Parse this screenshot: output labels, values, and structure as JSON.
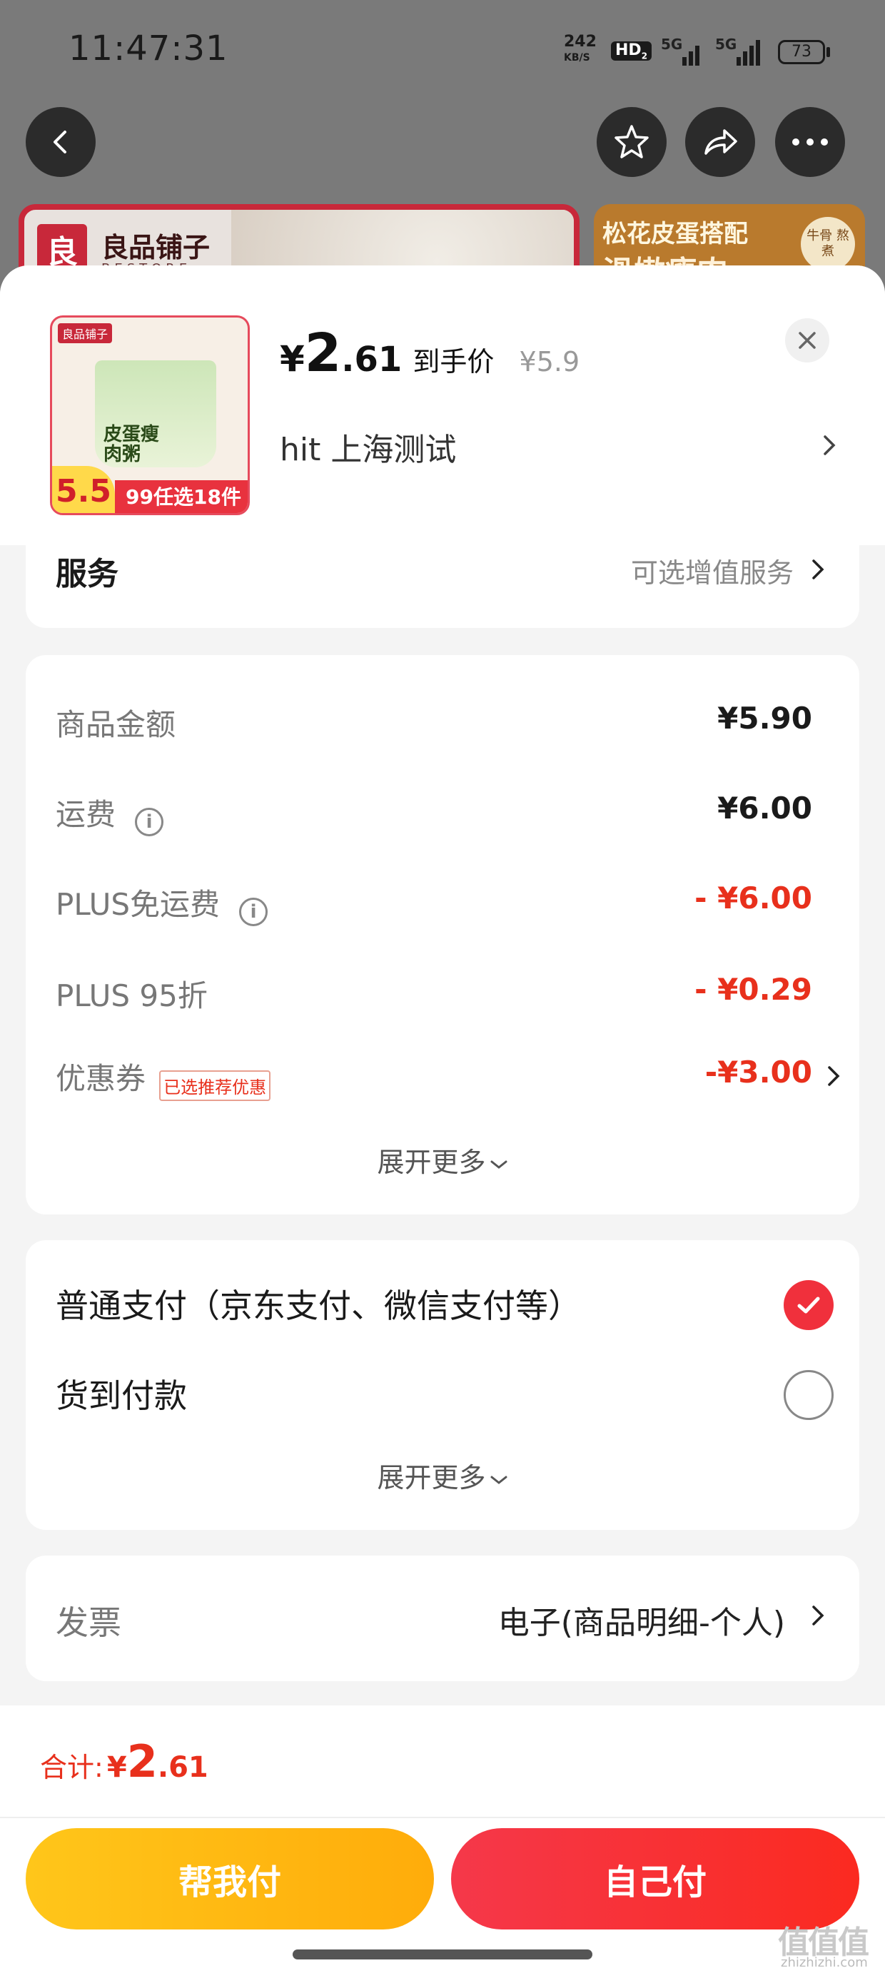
{
  "status_bar": {
    "time": "11:47:31",
    "net_speed_top": "242",
    "net_speed_bottom": "KB/S",
    "hd": "HD",
    "hd_sub": "2",
    "sig1": "5G",
    "sig2": "5G",
    "battery": "73"
  },
  "background": {
    "banner1_logo": "良",
    "banner1_name": "良品铺子",
    "banner1_sub": "BESTORE",
    "banner2_line1": "松花皮蛋搭配",
    "banner2_line2": "滑嫩瘦肉",
    "banner2_sticker": "牛骨 熬煮"
  },
  "product": {
    "currency": "¥",
    "price_int": "2",
    "price_dec": ".61",
    "price_tag": "到手价",
    "original_price": "¥5.9",
    "address": "hit  上海测试",
    "thumb_brand": "良品铺子",
    "thumb_pack_text": "皮蛋瘦肉粥",
    "thumb_price": "5.5",
    "thumb_promo": "99任选18件"
  },
  "service": {
    "label": "服务",
    "value": "可选增值服务"
  },
  "summary": {
    "rows": [
      {
        "label": "商品金额",
        "value": "¥5.90"
      },
      {
        "label": "运费",
        "value": "¥6.00"
      },
      {
        "label": "PLUS免运费",
        "value": "- ¥6.00"
      },
      {
        "label": "PLUS 95折",
        "value": "- ¥0.29"
      },
      {
        "label": "优惠券",
        "badge": "已选推荐优惠",
        "value": "-¥3.00"
      }
    ],
    "expand": "展开更多"
  },
  "payment": {
    "option1": "普通支付（京东支付、微信支付等）",
    "option2": "货到付款",
    "option1_selected": true,
    "expand": "展开更多"
  },
  "invoice": {
    "label": "发票",
    "value": "电子(商品明细-个人)"
  },
  "footer": {
    "total_label": "合计:",
    "total_currency": "¥",
    "total_int": "2",
    "total_dec": ".61",
    "btn_help": "帮我付",
    "btn_self": "自己付"
  },
  "watermark": {
    "main": "值值值",
    "sub": "zhizhizhi.com"
  },
  "colors": {
    "accent_red": "#e8301c",
    "help_btn": "#ffb400",
    "self_btn": "#f53a3a"
  },
  "icons": [
    "back-arrow-icon",
    "star-icon",
    "share-icon",
    "more-icon",
    "close-icon",
    "info-icon",
    "chevron-right-icon",
    "chevron-down-icon",
    "check-icon"
  ]
}
